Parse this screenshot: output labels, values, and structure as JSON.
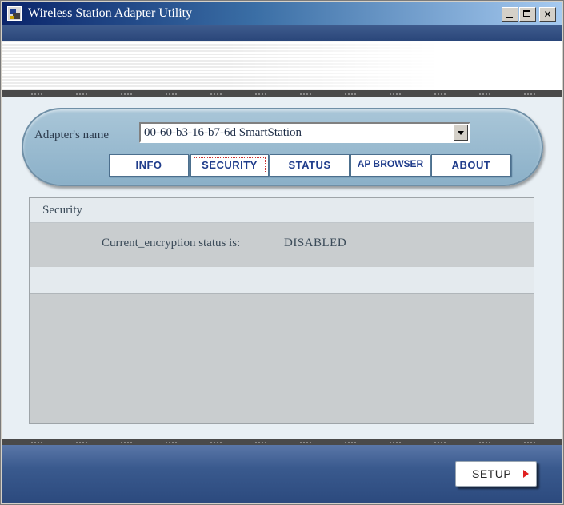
{
  "window": {
    "title": "Wireless Station Adapter Utility",
    "minimize_label": "_",
    "close_label": "✕"
  },
  "adapter": {
    "label": "Adapter's name",
    "selected": "00-60-b3-16-b7-6d  SmartStation"
  },
  "tabs": [
    {
      "label": "INFO",
      "active": false
    },
    {
      "label": "SECURITY",
      "active": true
    },
    {
      "label": "STATUS",
      "active": false
    },
    {
      "label": "AP BROWSER",
      "active": false
    },
    {
      "label": "ABOUT",
      "active": false
    }
  ],
  "panel": {
    "title": "Security",
    "status_label": "Current_encryption status is:",
    "status_value": "DISABLED"
  },
  "footer": {
    "setup_label": "SETUP"
  },
  "icons": {
    "app": "app-icon",
    "dropdown": "chevron-down-icon",
    "setup_arrow": "arrow-right-icon"
  },
  "colors": {
    "title_bar": "#0a246a",
    "tab_text": "#1f3c8b",
    "setup_arrow": "#e02020",
    "capsule": "#a9c6d8"
  }
}
